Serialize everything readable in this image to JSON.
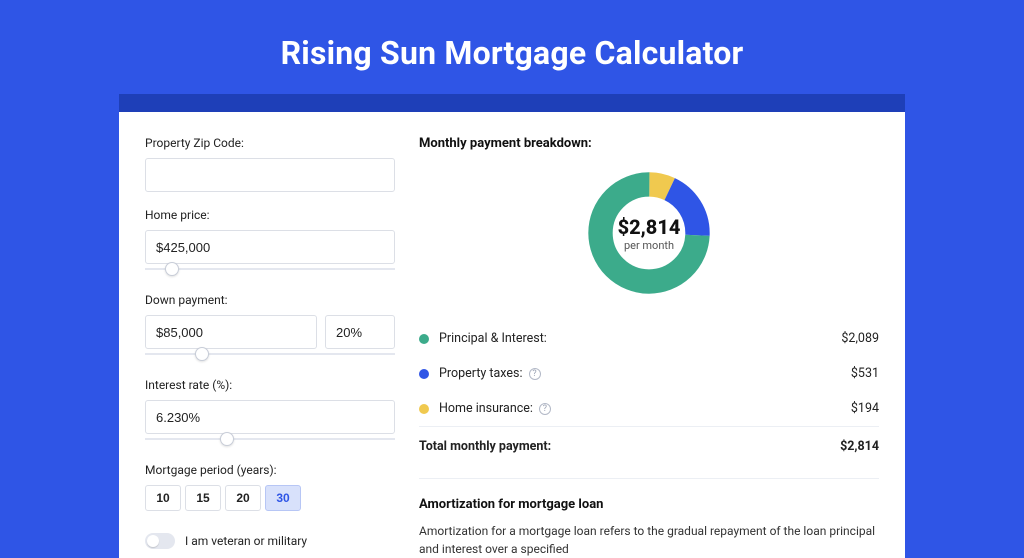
{
  "title": "Rising Sun Mortgage Calculator",
  "form": {
    "zip_label": "Property Zip Code:",
    "zip_value": "",
    "home_price_label": "Home price:",
    "home_price_value": "$425,000",
    "home_price_slider_pct": 8,
    "down_payment_label": "Down payment:",
    "down_payment_value": "$85,000",
    "down_payment_pct_value": "20%",
    "down_payment_slider_pct": 20,
    "interest_rate_label": "Interest rate (%):",
    "interest_rate_value": "6.230%",
    "interest_rate_slider_pct": 30,
    "period_label": "Mortgage period (years):",
    "period_options": [
      "10",
      "15",
      "20",
      "30"
    ],
    "period_selected": "30",
    "veteran_label": "I am veteran or military",
    "veteran_checked": false
  },
  "breakdown": {
    "title": "Monthly payment breakdown:",
    "donut": {
      "value": "$2,814",
      "sub": "per month"
    },
    "items": [
      {
        "color": "green",
        "label": "Principal & Interest:",
        "value": "$2,089",
        "info": false
      },
      {
        "color": "blue",
        "label": "Property taxes:",
        "value": "$531",
        "info": true
      },
      {
        "color": "yellow",
        "label": "Home insurance:",
        "value": "$194",
        "info": true
      }
    ],
    "total_label": "Total monthly payment:",
    "total_value": "$2,814",
    "colors": {
      "green": "#3cab8b",
      "blue": "#2f55e6",
      "yellow": "#f0c94f"
    }
  },
  "chart_data": {
    "type": "pie",
    "title": "Monthly payment breakdown",
    "series": [
      {
        "name": "Principal & Interest",
        "value": 2089,
        "color": "#3cab8b"
      },
      {
        "name": "Property taxes",
        "value": 531,
        "color": "#2f55e6"
      },
      {
        "name": "Home insurance",
        "value": 194,
        "color": "#f0c94f"
      }
    ],
    "total": 2814,
    "inner_radius_pct": 62
  },
  "amortization": {
    "title": "Amortization for mortgage loan",
    "text": "Amortization for a mortgage loan refers to the gradual repayment of the loan principal and interest over a specified"
  }
}
